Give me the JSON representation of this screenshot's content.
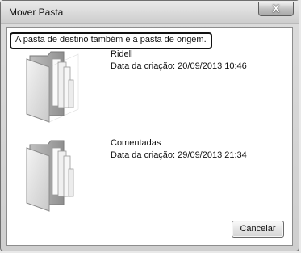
{
  "window": {
    "title": "Mover Pasta",
    "close_icon": "close-icon",
    "close_glyph": "X"
  },
  "message": "A pasta de destino também é a pasta de origem.",
  "items": [
    {
      "icon": "folder-icon",
      "name": "Ridell",
      "created": "Data da criação: 20/09/2013 10:46"
    },
    {
      "icon": "folder-icon",
      "name": "Comentadas",
      "created": "Data da criação: 29/09/2013 21:34"
    }
  ],
  "buttons": {
    "cancel_label": "Cancelar"
  }
}
